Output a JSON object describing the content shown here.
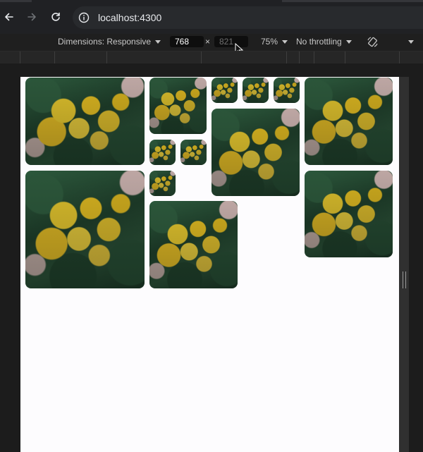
{
  "browser": {
    "url": "localhost:4300",
    "back_icon": "arrow-left-icon",
    "forward_icon": "arrow-right-icon",
    "reload_icon": "reload-icon",
    "site_info_icon": "info-circle-icon"
  },
  "device_toolbar": {
    "dimensions_label": "Dimensions: Responsive",
    "width": "768",
    "height": "821",
    "zoom": "75%",
    "throttling": "No throttling",
    "rotate_icon": "rotate-icon",
    "more_icon": "chevron-down-icon",
    "separator": "×"
  },
  "gallery": {
    "image_alt": "Lemon tree photo",
    "tile_count": 14
  },
  "colors": {
    "chrome_bg": "#202124",
    "viewport_bg": "#fdfcfe",
    "lemon": "#f6cf2c",
    "leaf": "#2f5e40"
  }
}
